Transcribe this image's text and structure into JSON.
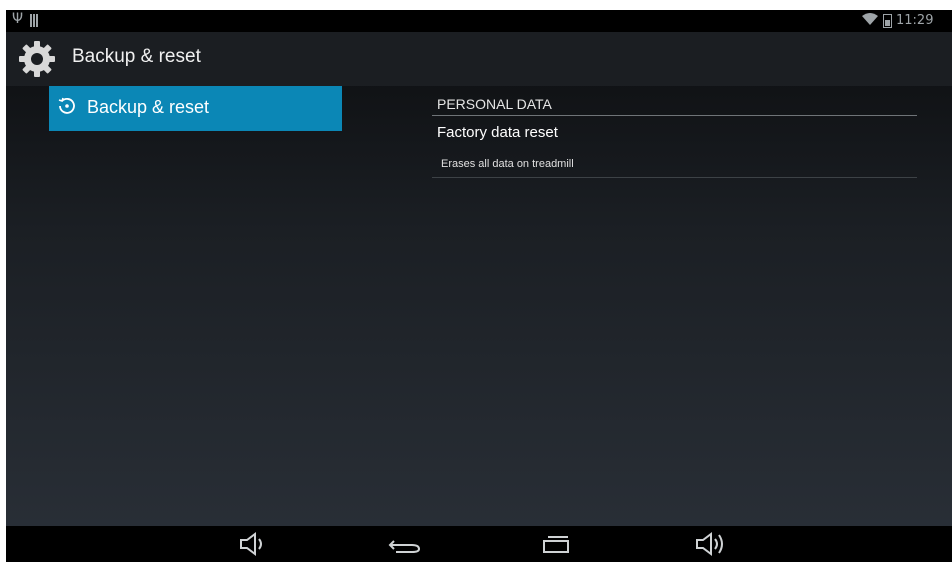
{
  "status_bar": {
    "usb_icon": "usb-icon",
    "sd_icon": "sd-card-icon",
    "wifi_icon": "wifi-icon",
    "battery_icon": "battery-icon",
    "time": "11:29"
  },
  "action_bar": {
    "icon": "settings-gear-icon",
    "title": "Backup & reset"
  },
  "left_pane": {
    "items": [
      {
        "label": "Backup & reset",
        "icon": "history-icon",
        "selected": true
      }
    ]
  },
  "right_pane": {
    "section_header": "PERSONAL DATA",
    "items": [
      {
        "title": "Factory data reset",
        "summary": "Erases all data on treadmill"
      }
    ]
  },
  "nav_bar": {
    "buttons": [
      "volume-down-icon",
      "back-icon",
      "recents-icon",
      "volume-up-icon"
    ]
  },
  "colors": {
    "accent": "#0b87b6",
    "status_bar": "#000000",
    "action_bar": "#1b1e22"
  }
}
